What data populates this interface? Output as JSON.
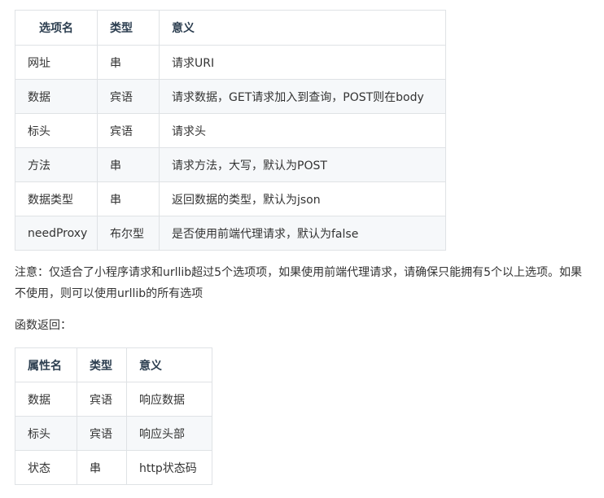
{
  "options_table": {
    "headers": [
      "选项名",
      "类型",
      "意义"
    ],
    "rows": [
      [
        "网址",
        "串",
        "请求URI"
      ],
      [
        "数据",
        "宾语",
        "请求数据，GET请求加入到查询，POST则在body"
      ],
      [
        "标头",
        "宾语",
        "请求头"
      ],
      [
        "方法",
        "串",
        "请求方法，大写，默认为POST"
      ],
      [
        "数据类型",
        "串",
        "返回数据的类型，默认为json"
      ],
      [
        "needProxy",
        "布尔型",
        "是否使用前端代理请求，默认为false"
      ]
    ]
  },
  "note": "注意：仅适合了小程序请求和urllib超过5个选项项，如果使用前端代理请求，请确保只能拥有5个以上选项。如果不使用，则可以使用urllib的所有选项",
  "returns_label": "函数返回：",
  "return_table": {
    "headers": [
      "属性名",
      "类型",
      "意义"
    ],
    "rows": [
      [
        "数据",
        "宾语",
        "响应数据"
      ],
      [
        "标头",
        "宾语",
        "响应头部"
      ],
      [
        "状态",
        "串",
        "http状态码"
      ]
    ]
  }
}
